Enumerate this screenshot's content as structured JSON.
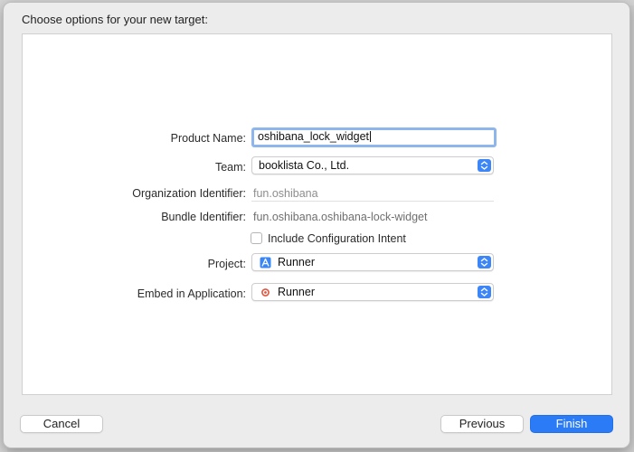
{
  "dialog": {
    "title": "Choose options for your new target:"
  },
  "form": {
    "product_name_label": "Product Name:",
    "product_name_value": "oshibana_lock_widget",
    "team_label": "Team:",
    "team_value": "booklista Co., Ltd.",
    "org_id_label": "Organization Identifier:",
    "org_id_value": "fun.oshibana",
    "bundle_id_label": "Bundle Identifier:",
    "bundle_id_value": "fun.oshibana.oshibana-lock-widget",
    "include_intent_label": "Include Configuration Intent",
    "include_intent_checked": false,
    "project_label": "Project:",
    "project_value": "Runner",
    "project_icon": "xcode-project-icon",
    "embed_label": "Embed in Application:",
    "embed_value": "Runner",
    "embed_icon": "app-target-icon"
  },
  "buttons": {
    "cancel": "Cancel",
    "previous": "Previous",
    "finish": "Finish"
  },
  "colors": {
    "accent": "#2a7bf5",
    "focus_ring": "#8fb6ec",
    "stepper": "#3d86f7"
  }
}
